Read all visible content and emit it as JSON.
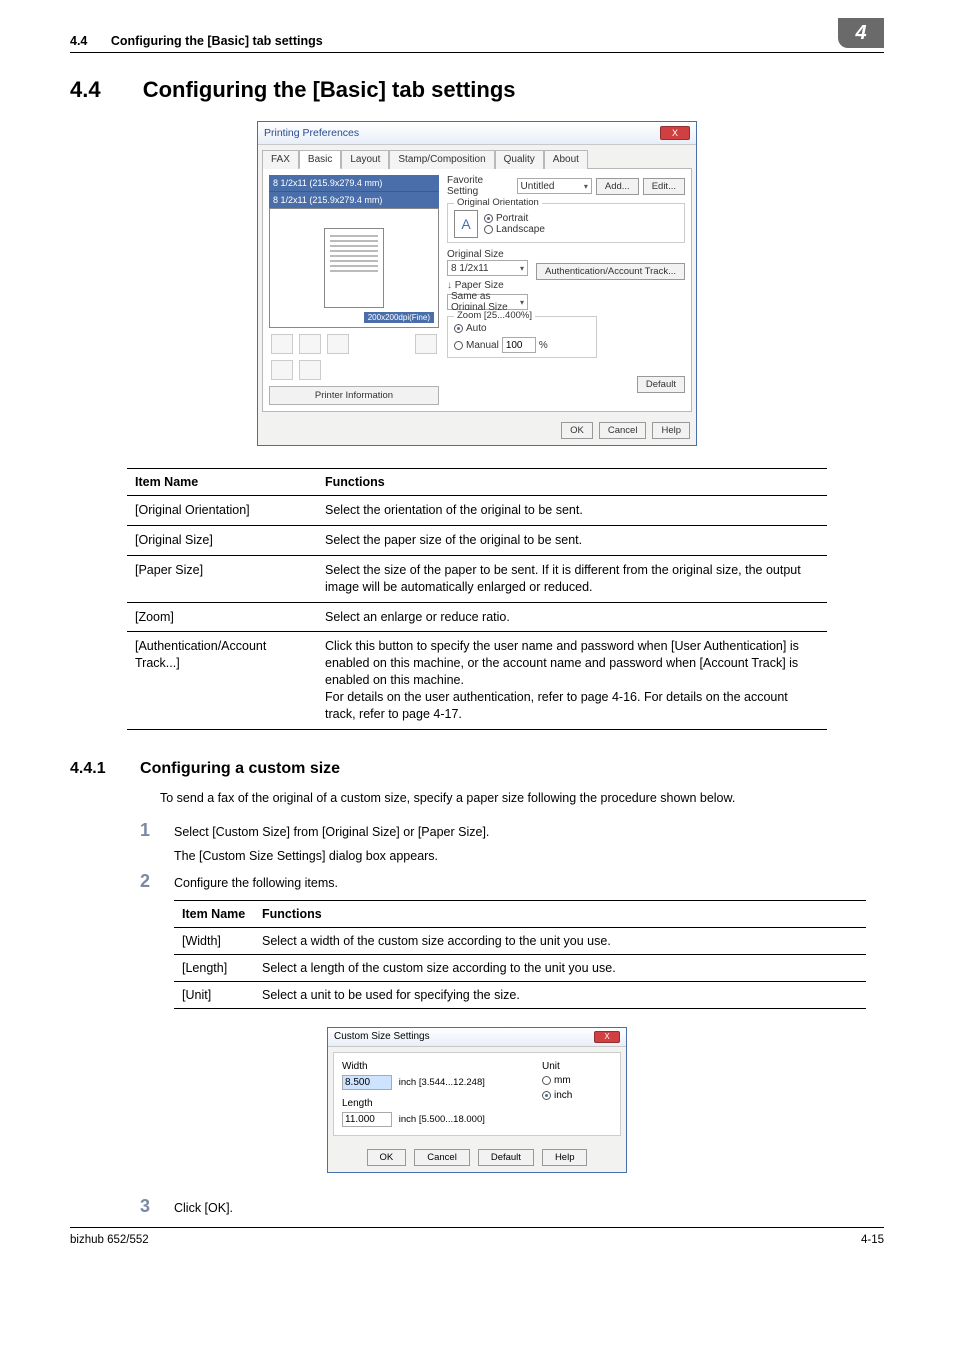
{
  "header": {
    "section_number": "4.4",
    "section_title_short": "Configuring the [Basic] tab settings",
    "badge": "4"
  },
  "h1": {
    "number": "4.4",
    "title": "Configuring the [Basic] tab settings"
  },
  "printing_prefs": {
    "window_title": "Printing Preferences",
    "close": "X",
    "tabs": {
      "fax": "FAX",
      "basic": "Basic",
      "layout": "Layout",
      "stamp": "Stamp/Composition",
      "quality": "Quality",
      "about": "About"
    },
    "preview": {
      "size_line1": "8 1/2x11 (215.9x279.4 mm)",
      "size_line2": "8 1/2x11 (215.9x279.4 mm)",
      "resolution": "200x200dpi(Fine)",
      "printer_info_btn": "Printer Information"
    },
    "controls": {
      "fav_label": "Favorite Setting",
      "fav_value": "Untitled",
      "add_btn": "Add...",
      "edit_btn": "Edit...",
      "orient_group": "Original Orientation",
      "orient_portrait": "Portrait",
      "orient_landscape": "Landscape",
      "orig_size_label": "Original Size",
      "orig_size_value": "8 1/2x11",
      "paper_size_label": "Paper Size",
      "paper_size_value": "Same as Original Size",
      "auth_btn": "Authentication/Account Track...",
      "zoom_group": "Zoom [25...400%]",
      "zoom_auto": "Auto",
      "zoom_manual": "Manual",
      "zoom_value": "100",
      "zoom_pct": "%",
      "default_btn": "Default"
    },
    "footer": {
      "ok": "OK",
      "cancel": "Cancel",
      "help": "Help"
    }
  },
  "table1": {
    "h1": "Item Name",
    "h2": "Functions",
    "rows": [
      {
        "name": "[Original Orientation]",
        "func": "Select the orientation of the original to be sent."
      },
      {
        "name": "[Original Size]",
        "func": "Select the paper size of the original to be sent."
      },
      {
        "name": "[Paper Size]",
        "func": "Select the size of the paper to be sent. If it is different from the original size, the output image will be automatically enlarged or reduced."
      },
      {
        "name": "[Zoom]",
        "func": "Select an enlarge or reduce ratio."
      },
      {
        "name": "[Authentication/Account Track...]",
        "func": "Click this button to specify the user name and password when [User Authentication] is enabled on this machine, or the account name and password when [Account Track] is enabled on this machine.\nFor details on the user authentication, refer to page 4-16. For details on the account track, refer to page 4-17."
      }
    ]
  },
  "h2": {
    "number": "4.4.1",
    "title": "Configuring a custom size"
  },
  "para1": "To send a fax of the original of a custom size, specify a paper size following the procedure shown below.",
  "steps": {
    "s1a": "Select [Custom Size] from [Original Size] or [Paper Size].",
    "s1b": "The [Custom Size Settings] dialog box appears.",
    "s2": "Configure the following items.",
    "s3": "Click [OK]."
  },
  "table2": {
    "h1": "Item Name",
    "h2": "Functions",
    "rows": [
      {
        "name": "[Width]",
        "func": "Select a width of the custom size according to the unit you use."
      },
      {
        "name": "[Length]",
        "func": "Select a length of the custom size according to the unit you use."
      },
      {
        "name": "[Unit]",
        "func": "Select a unit to be used for specifying the size."
      }
    ]
  },
  "custom_size": {
    "title": "Custom Size Settings",
    "close": "X",
    "width_label": "Width",
    "width_value": "8.500",
    "width_range": "inch [3.544...12.248]",
    "length_label": "Length",
    "length_value": "11.000",
    "length_range": "inch [5.500...18.000]",
    "unit_label": "Unit",
    "unit_mm": "mm",
    "unit_inch": "inch",
    "ok": "OK",
    "cancel": "Cancel",
    "default": "Default",
    "help": "Help"
  },
  "footer": {
    "left": "bizhub 652/552",
    "right": "4-15"
  },
  "step_numbers": {
    "n1": "1",
    "n2": "2",
    "n3": "3"
  }
}
